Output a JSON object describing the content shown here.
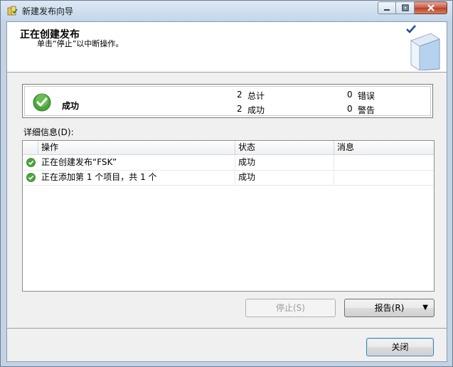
{
  "window": {
    "title": "新建发布向导"
  },
  "header": {
    "title": "正在创建发布",
    "subtitle": "单击“停止”以中断操作。"
  },
  "summary": {
    "status": "成功",
    "total_count": "2",
    "total_label": "总计",
    "success_count": "2",
    "success_label": "成功",
    "error_count": "0",
    "error_label": "错误",
    "warning_count": "0",
    "warning_label": "警告"
  },
  "details": {
    "label": "详细信息(D):",
    "columns": [
      "操作",
      "状态",
      "消息"
    ],
    "rows": [
      {
        "action": "正在创建发布“FSK”",
        "status": "成功",
        "message": ""
      },
      {
        "action": "正在添加第 1 个项目，共 1 个",
        "status": "成功",
        "message": ""
      }
    ]
  },
  "buttons": {
    "stop": "停止(S)",
    "report": "报告(R)",
    "close": "关闭"
  },
  "colors": {
    "success_green": "#3a9a2c",
    "titlebar": "#c4d6ea",
    "close_button": "#c65a42"
  },
  "icons": [
    "app-icon",
    "minimize-icon",
    "maximize-icon",
    "close-icon",
    "book-check-icon",
    "success-check-icon",
    "dropdown-arrow-icon"
  ]
}
